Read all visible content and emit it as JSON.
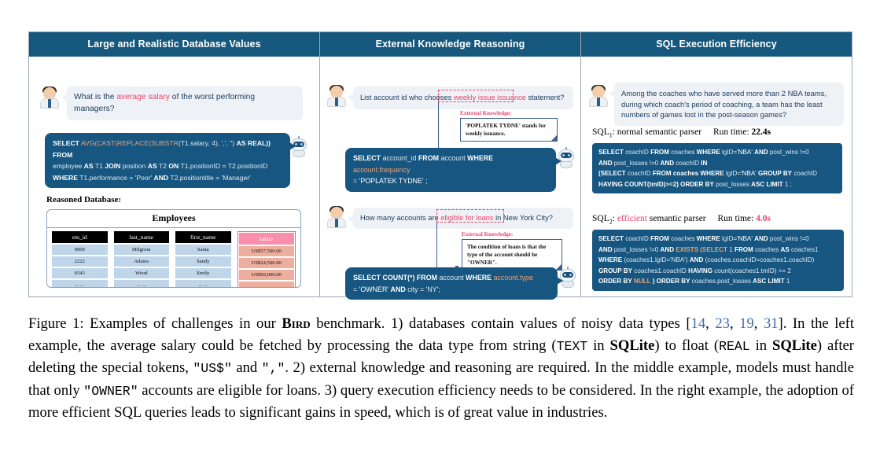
{
  "panels": [
    {
      "id": "left",
      "header": "Large and Realistic Database Values",
      "question_pre": "What is the ",
      "question_hl": "average salary",
      "question_post": " of the worst performing managers?",
      "sql_lines": [
        "SELECT AVG(CAST(REPLACE(SUBSTR(T1.salary, 4), ',', '') AS REAL)) FROM",
        "employee AS T1 JOIN position AS T2 ON T1.positionID = T2.positionID",
        "WHERE T1.performance = 'Poor' AND T2.positiontitle = 'Manager'"
      ],
      "db_label": "Reasoned Database:",
      "table_title": "Employees",
      "columns": [
        "em_id",
        "last_name",
        "first_name",
        "salary"
      ],
      "rows": [
        [
          "0000",
          "Milgrom",
          "Santa",
          "US$57,500.00"
        ],
        [
          "2222",
          "Adams",
          "Sandy",
          "US$24,500.00"
        ],
        [
          "6543",
          "Wood",
          "Emily",
          "US$69,000.00"
        ],
        [
          "... ...",
          "... ...",
          "... ...",
          "... ..."
        ]
      ]
    },
    {
      "id": "middle",
      "header": "External Knowledge Reasoning",
      "q1_pre": "List account id who chooses ",
      "q1_hl": "weekly issue issuance",
      "q1_post": " statement?",
      "ek1_title": "External Knowledge:",
      "ek1_text": "'POPLATEK TYDNE' stands for weekly issuance.",
      "sql1_lines": [
        "SELECT account_id FROM account WHERE account.frequency",
        "= 'POPLATEK TYDNE' ;"
      ],
      "q2_pre": "How many accounts are ",
      "q2_hl": "eligible for loans",
      "q2_post": " in New York City?",
      "ek2_title": "External Knowledge:",
      "ek2_text": "The condition of loans is that the type of the account should be \"OWNER\".",
      "sql2_lines": [
        "SELECT COUNT(*) FROM account WHERE account.type",
        "= 'OWNER' AND city = 'NY';"
      ]
    },
    {
      "id": "right",
      "header": "SQL Execution Efficiency",
      "question": "Among the coaches who have served more than 2 NBA teams, during which coach's period of coaching, a team has the least numbers of games lost in the post-season games?",
      "sql1_label_name": "SQL",
      "sql1_label_sub": "1",
      "sql1_label_rest": ": normal semantic parser",
      "sql1_runtime_label": "Run time:",
      "sql1_runtime_value": "22.4s",
      "sql1_lines": [
        "SELECT coachID FROM coaches WHERE lgID='NBA' AND post_wins !=0",
        "AND post_losses !=0 AND coachID IN",
        "(SELECT coachID FROM coaches WHERE lgID='NBA' GROUP BY coachID",
        "HAVING COUNT(tmID)>=2) ORDER BY post_losses ASC LIMIT 1 ;"
      ],
      "sql2_label_name": "SQL",
      "sql2_label_sub": "2",
      "sql2_label_mid": ": ",
      "sql2_label_hl": "efficient",
      "sql2_label_rest": " semantic parser",
      "sql2_runtime_label": "Run time:",
      "sql2_runtime_value": "4.0s",
      "sql2_lines": [
        "SELECT coachID FROM coaches WHERE lgID='NBA' AND post_wins !=0",
        "AND post_losses !=0 AND EXISTS (SELECT 1 FROM coaches AS coaches1",
        "WHERE (coaches1.lgID='NBA') AND (coaches.coachID=coaches1.coachID)",
        "GROUP BY coaches1.coachID HAVING count(coaches1.tmID) >= 2",
        "ORDER BY NULL ) ORDER BY coaches.post_losses ASC LIMIT 1"
      ]
    }
  ],
  "caption": {
    "t1": "Figure 1: Examples of challenges in our ",
    "bird": "Bird",
    "t2": " benchmark. 1) databases contain values of noisy data types [",
    "c1": "14",
    "cs1": ", ",
    "c2": "23",
    "cs2": ", ",
    "c3": "19",
    "cs3": ", ",
    "c4": "31",
    "t3": "]. In the left example, the average salary could be fetched by processing the data type from string (",
    "m1": "TEXT",
    "t4": " in ",
    "b1": "SQLite",
    "t5": ") to float (",
    "m2": "REAL",
    "t6": " in ",
    "b2": "SQLite",
    "t7": ") after deleting the special tokens, ",
    "m3": "\"US$\"",
    "t8": " and ",
    "m4": "\",\"",
    "t9": ". 2) external knowledge and reasoning are required. In the middle example, models must handle that only ",
    "m5": "\"OWNER\"",
    "t10": " accounts are eligible for loans. 3) query execution efficiency needs to be considered. In the right example, the adoption of more efficient SQL queries leads to significant gains in speed, which is of great value in industries."
  },
  "colors": {
    "header_bg": "#16587d",
    "sql_bg": "#175680",
    "accent_pink": "#e8476f",
    "bubble_bg": "#eef1f5",
    "cell_blue": "#bed5ea",
    "salary_header": "#f98fad",
    "salary_cell": "#edae9e"
  }
}
